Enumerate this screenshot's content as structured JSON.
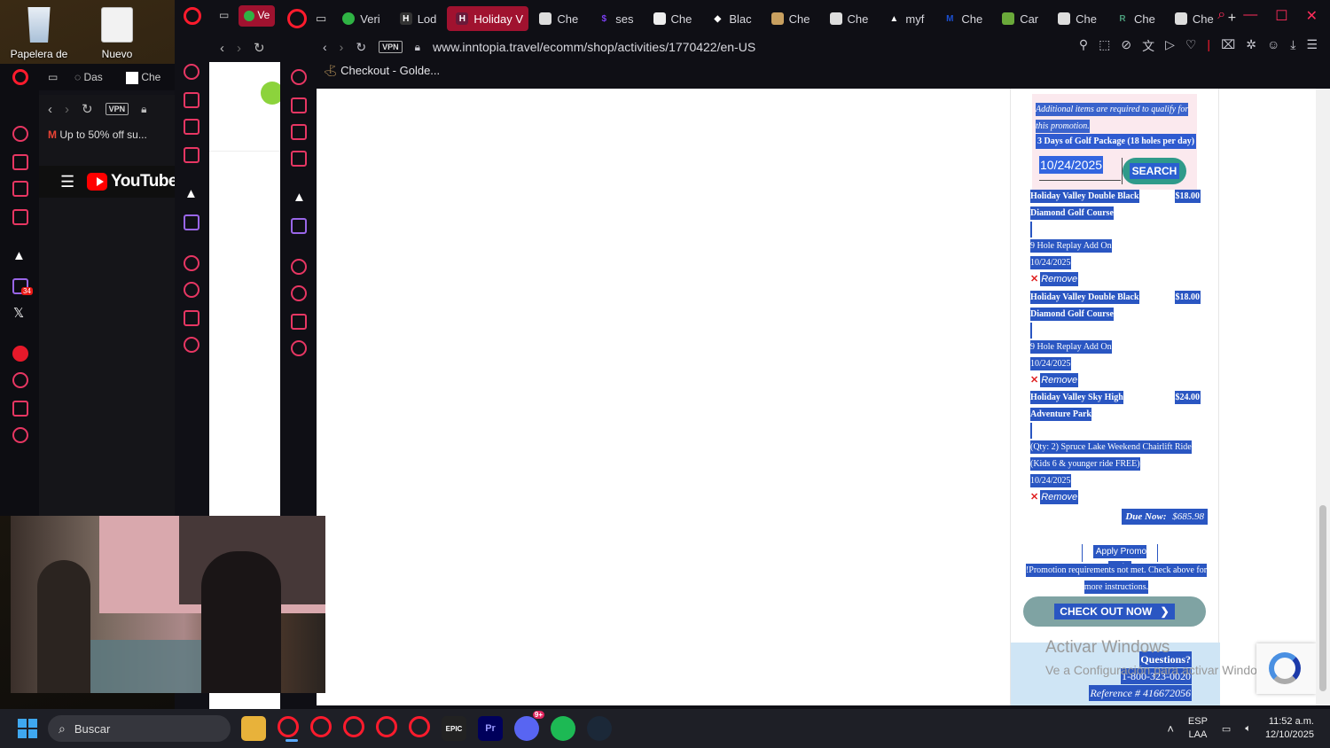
{
  "desktop": {
    "icons": [
      {
        "label": "Papelera de",
        "icon": "recycle-bin-icon"
      },
      {
        "label": "Nuevo",
        "icon": "text-document-icon"
      }
    ]
  },
  "win1": {
    "tabs": [
      "Das",
      "Che"
    ],
    "gmail_title": "Up to 50% off su...",
    "youtube": "YouTube",
    "twitch_badge": "34",
    "vpn": "VPN"
  },
  "win2": {
    "tab": "Ve"
  },
  "browser": {
    "tabs": [
      {
        "label": "Veri",
        "fav_color": "#2fb344"
      },
      {
        "label": "Lod",
        "fav_color": "#222"
      },
      {
        "label": "Holiday V",
        "fav_color": "#cc3355",
        "active": true
      },
      {
        "label": "Che",
        "fav_color": "#eee"
      },
      {
        "label": "ses",
        "fav_color": "#7b3ff2"
      },
      {
        "label": "Che",
        "fav_color": "#eee"
      },
      {
        "label": "Blac",
        "fav_color": "#fff"
      },
      {
        "label": "Che",
        "fav_color": "#c8a060"
      },
      {
        "label": "Che",
        "fav_color": "#eee"
      },
      {
        "label": "myf",
        "fav_color": "#ddd"
      },
      {
        "label": "Che",
        "fav_color": "#1b4fd1"
      },
      {
        "label": "Car",
        "fav_color": "#6aa93a"
      },
      {
        "label": "Che",
        "fav_color": "#eee"
      },
      {
        "label": "Che",
        "fav_color": "#4a9b7a"
      },
      {
        "label": "Che",
        "fav_color": "#eee"
      }
    ],
    "vpn": "VPN",
    "url": "www.inntopia.travel/ecomm/shop/activities/1770422/en-US",
    "bookmark": "Checkout - Golde..."
  },
  "checkout": {
    "promo_note": "Additional items are required to qualify for this promotion.",
    "promo_package": "3 Days of Golf Package (18 holes per day)",
    "date_value": "10/24/2025",
    "search_label": "SEARCH",
    "items": [
      {
        "name": "Holiday Valley Double Black Diamond Golf Course",
        "price": "$18.00",
        "desc": "9 Hole Replay Add On",
        "date": "10/24/2025",
        "remove": "Remove"
      },
      {
        "name": "Holiday Valley Double Black Diamond Golf Course",
        "price": "$18.00",
        "desc": "9 Hole Replay Add On",
        "date": "10/24/2025",
        "remove": "Remove"
      },
      {
        "name": "Holiday Valley Sky High Adventure Park",
        "price": "$24.00",
        "desc": "(Qty: 2) Spruce Lake Weekend Chairlift Ride (Kids 6 & younger ride FREE)",
        "date": "10/24/2025",
        "remove": "Remove"
      }
    ],
    "due_now_label": "Due Now:",
    "due_now_value": "$685.98",
    "apply_promo": "Apply Promo Code",
    "promo_message": "!Promotion requirements not met. Check above for more instructions.",
    "checkout_label": "CHECK OUT NOW",
    "questions_label": "Questions?",
    "phone": "1-800-323-0020",
    "reference": "Reference # 416672056"
  },
  "watermark": {
    "line1": "Activar Windows",
    "line2": "Ve a Configuración para activar Windows."
  },
  "taskbar": {
    "search_placeholder": "Buscar",
    "discord_badge": "9+",
    "lang_line1": "ESP",
    "lang_line2": "LAA",
    "time": "11:52 a.m.",
    "date": "12/10/2025"
  },
  "colors": {
    "opera_red": "#ff1b2d",
    "selection_blue": "#2a56c2",
    "search_button": "#2f9a8a",
    "checkout_button": "#7fa3a3",
    "promo_bg": "#fbe9ee",
    "questions_bg": "#cfe5f5"
  }
}
